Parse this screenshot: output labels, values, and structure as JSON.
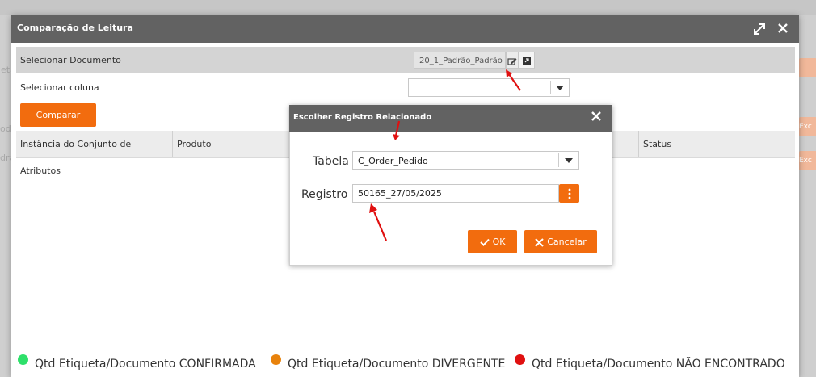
{
  "dialog": {
    "title": "Comparação de Leitura",
    "select_document_label": "Selecionar Documento",
    "document_value": "20_1_Padrão_Padrão",
    "select_column_label": "Selecionar coluna",
    "compare_button": "Comparar",
    "table_headers": [
      "Instância do Conjunto de Atributos",
      "Produto",
      "Status"
    ],
    "legend": [
      {
        "color": "#2ee06a",
        "label": "Qtd Etiqueta/Documento CONFIRMADA"
      },
      {
        "color": "#e8820c",
        "label": "Qtd Etiqueta/Documento DIVERGENTE"
      },
      {
        "color": "#e01010",
        "label": "Qtd Etiqueta/Documento NÃO ENCONTRADO"
      }
    ]
  },
  "sub_dialog": {
    "title": "Escolher Registro Relacionado",
    "tabela_label": "Tabela",
    "tabela_value": "C_Order_Pedido",
    "registro_label": "Registro",
    "registro_value": "50165_27/05/2025",
    "ok_button": "OK",
    "cancel_button": "Cancelar"
  },
  "background": {
    "peek_texts": [
      "eta",
      "odu",
      "dra"
    ],
    "peek_buttons": [
      "Exc",
      "Exc"
    ]
  },
  "colors": {
    "accent": "#f26c0e",
    "header": "#626262",
    "annotation_arrow": "#e01010"
  }
}
